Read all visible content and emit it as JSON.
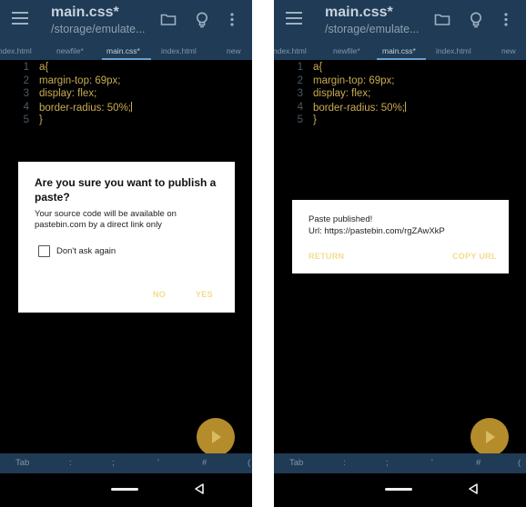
{
  "left": {
    "appbar": {
      "title": "main.css*",
      "subtitle": "/storage/emulate..."
    },
    "tabs": [
      "index.html",
      "newfile*",
      "main.css*",
      "index.html",
      "new"
    ],
    "code": [
      {
        "num": "1",
        "text": "a{"
      },
      {
        "num": "2",
        "text": "margin-top: 69px;"
      },
      {
        "num": "3",
        "text": "display: flex;"
      },
      {
        "num": "4",
        "text": "border-radius: 50%;"
      },
      {
        "num": "5",
        "text": "}"
      }
    ],
    "dialog": {
      "title": "Are you sure you want to publish a paste?",
      "message": "Your source code will be available on pastebin.com by a direct link only",
      "checkbox_label": "Don't ask again",
      "checkbox_checked": false,
      "no_label": "NO",
      "yes_label": "YES"
    },
    "keys": [
      "Tab",
      ":",
      ";",
      "'",
      "#",
      "("
    ]
  },
  "right": {
    "appbar": {
      "title": "main.css*",
      "subtitle": "/storage/emulate..."
    },
    "tabs": [
      "index.html",
      "newfile*",
      "main.css*",
      "index.html",
      "new"
    ],
    "code": [
      {
        "num": "1",
        "text": "a{"
      },
      {
        "num": "2",
        "text": "margin-top: 69px;"
      },
      {
        "num": "3",
        "text": "display: flex;"
      },
      {
        "num": "4",
        "text": "border-radius: 50%;"
      },
      {
        "num": "5",
        "text": "}"
      }
    ],
    "dialog": {
      "title": "Paste published!",
      "url": "Url: https://pastebin.com/rgZAwXkP",
      "return_label": "RETURN",
      "copy_label": "COPY URL"
    },
    "keys": [
      "Tab",
      ":",
      ";",
      "'",
      "#",
      "("
    ]
  },
  "colors": {
    "appbar": "#1f3b55",
    "code_text": "#c9ac53",
    "dialog_button": "#f2dc8c",
    "fab": "#b48c2c"
  }
}
